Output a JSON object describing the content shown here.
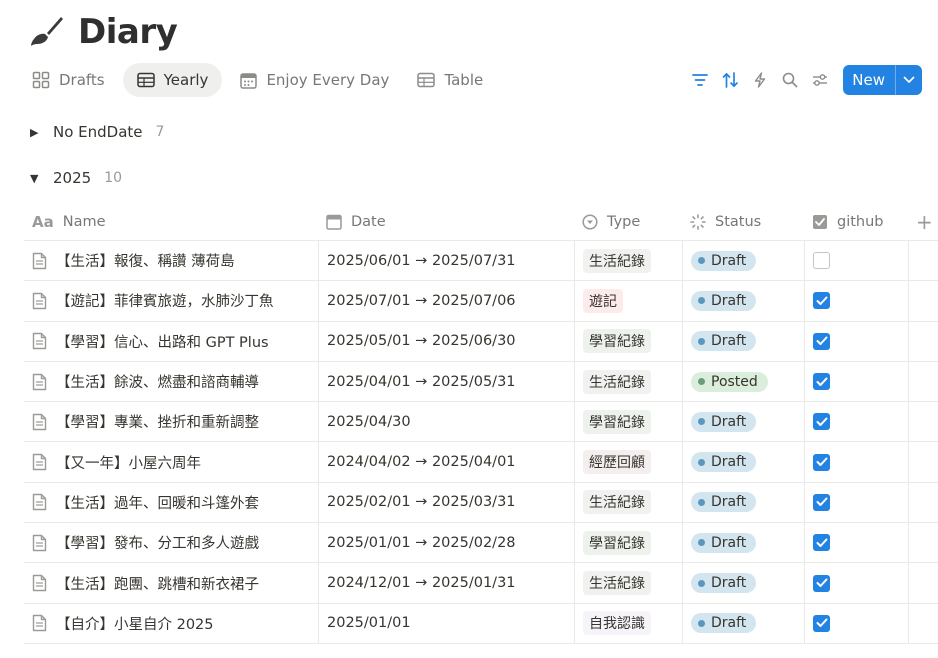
{
  "page": {
    "title": "Diary",
    "icon": "paintbrush-icon"
  },
  "tabs": [
    {
      "label": "Drafts",
      "icon": "gallery-icon",
      "active": false
    },
    {
      "label": "Yearly",
      "icon": "table-icon",
      "active": true
    },
    {
      "label": "Enjoy Every Day",
      "icon": "calendar-icon",
      "active": false
    },
    {
      "label": "Table",
      "icon": "table-icon",
      "active": false
    }
  ],
  "toolbar": {
    "icons": [
      "filter-icon",
      "sort-icon",
      "automation-bolt-icon",
      "search-icon",
      "settings-sliders-icon"
    ],
    "new_label": "New",
    "accent": "#2383e2"
  },
  "groups": [
    {
      "label": "No EndDate",
      "count": "7",
      "expanded": false
    },
    {
      "label": "2025",
      "count": "10",
      "expanded": true
    }
  ],
  "columns": {
    "name": "Name",
    "date": "Date",
    "type": "Type",
    "status": "Status",
    "github": "github",
    "add": "+"
  },
  "rows": [
    {
      "name": "【生活】報復、稱讚 薄荷島",
      "date": "2025/06/01 → 2025/07/31",
      "type": "生活紀錄",
      "type_color": "gray",
      "status": "Draft",
      "github": false
    },
    {
      "name": "【遊記】菲律賓旅遊，水肺沙丁魚",
      "date": "2025/07/01 → 2025/07/06",
      "type": "遊記",
      "type_color": "red",
      "status": "Draft",
      "github": true
    },
    {
      "name": "【學習】信心、出路和 GPT Plus",
      "date": "2025/05/01 → 2025/06/30",
      "type": "學習紀錄",
      "type_color": "green",
      "status": "Draft",
      "github": true
    },
    {
      "name": "【生活】餘波、燃盡和諮商輔導",
      "date": "2025/04/01 → 2025/05/31",
      "type": "生活紀錄",
      "type_color": "gray",
      "status": "Posted",
      "github": true
    },
    {
      "name": "【學習】專業、挫折和重新調整",
      "date": "2025/04/30",
      "type": "學習紀錄",
      "type_color": "green",
      "status": "Draft",
      "github": true
    },
    {
      "name": "【又一年】小屋六周年",
      "date": "2024/04/02 → 2025/04/01",
      "type": "經歷回顧",
      "type_color": "brown",
      "status": "Draft",
      "github": true
    },
    {
      "name": "【生活】過年、回暖和斗篷外套",
      "date": "2025/02/01 → 2025/03/31",
      "type": "生活紀錄",
      "type_color": "gray",
      "status": "Draft",
      "github": true
    },
    {
      "name": "【學習】發布、分工和多人遊戲",
      "date": "2025/01/01 → 2025/02/28",
      "type": "學習紀錄",
      "type_color": "green",
      "status": "Draft",
      "github": true
    },
    {
      "name": "【生活】跑團、跳槽和新衣裙子",
      "date": "2024/12/01 → 2025/01/31",
      "type": "生活紀錄",
      "type_color": "gray",
      "status": "Draft",
      "github": true
    },
    {
      "name": "【自介】小星自介 2025",
      "date": "2025/01/01",
      "type": "自我認識",
      "type_color": "purple",
      "status": "Draft",
      "github": true
    }
  ],
  "colors": {
    "tag_gray": "#f1f1ef",
    "tag_red": "#fdebec",
    "tag_green": "#edf3ec",
    "tag_brown": "#f4eeee",
    "tag_purple": "#f6f3f9",
    "status_draft_bg": "#d3e5ef",
    "status_draft_dot": "#5b97bd",
    "status_posted_bg": "#dbeddb",
    "status_posted_dot": "#6c9b7d"
  }
}
